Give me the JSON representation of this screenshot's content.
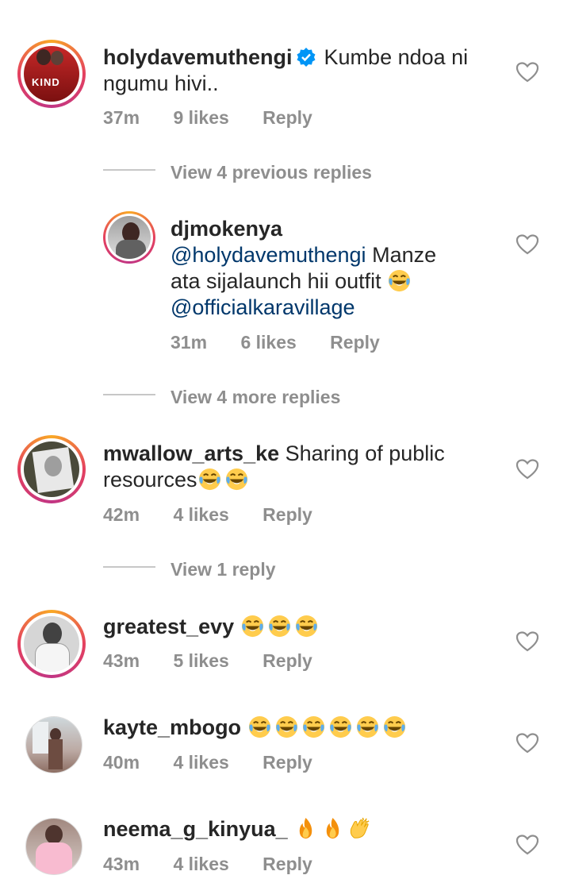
{
  "comments": [
    {
      "username": "holydavemuthengi",
      "verified": true,
      "text": "Kumbe ndoa ni ngumu hivi..",
      "text_line1": "Kumbe ndoa ni",
      "text_line2": "ngumu hivi..",
      "time": "37m",
      "likes": "9 likes",
      "reply": "Reply",
      "avatar_text": "KIND"
    },
    {
      "view_previous": "View 4 previous replies"
    },
    {
      "username": "djmokenya",
      "mention1": "@holydavemuthengi",
      "text_after_mention": "Manze",
      "text_line2": "ata sijalaunch hii outfit",
      "mention2": "@officialkaravillage",
      "time": "31m",
      "likes": "6 likes",
      "reply": "Reply"
    },
    {
      "view_more": "View 4 more replies"
    },
    {
      "username": "mwallow_arts_ke",
      "text_line1": "Sharing of public",
      "text_line2": "resources",
      "time": "42m",
      "likes": "4 likes",
      "reply": "Reply"
    },
    {
      "view_one": "View 1 reply"
    },
    {
      "username": "greatest_evy",
      "time": "43m",
      "likes": "5 likes",
      "reply": "Reply"
    },
    {
      "username": "kayte_mbogo",
      "time": "40m",
      "likes": "4 likes",
      "reply": "Reply"
    },
    {
      "username": "neema_g_kinyua_",
      "time": "43m",
      "likes": "4 likes",
      "reply": "Reply"
    }
  ],
  "icons": {
    "heart": "heart-outline-icon",
    "verified": "verified-badge-icon",
    "laugh": "face-with-tears-of-joy-emoji",
    "fire": "fire-emoji",
    "clap": "clapping-hands-emoji"
  },
  "colors": {
    "text": "#262626",
    "meta": "#8e8e8e",
    "mention": "#00376b",
    "verified": "#0095f6"
  }
}
